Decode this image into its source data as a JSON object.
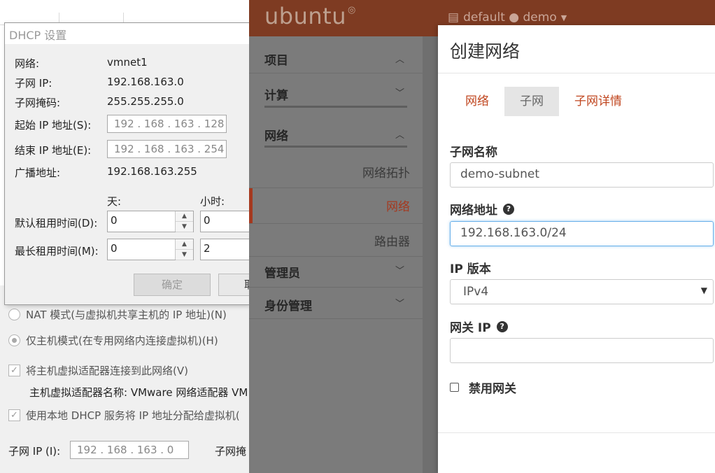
{
  "vmware": {
    "dhcp_dialog": {
      "title": "DHCP 设置",
      "network_label": "网络:",
      "network_value": "vmnet1",
      "subnet_ip_label": "子网 IP:",
      "subnet_ip_value": "192.168.163.0",
      "subnet_mask_label": "子网掩码:",
      "subnet_mask_value": "255.255.255.0",
      "start_ip_label": "起始 IP 地址(S):",
      "start_ip_value": "192 . 168 . 163 . 128",
      "end_ip_label": "结束 IP 地址(E):",
      "end_ip_value": "192 . 168 . 163 . 254",
      "broadcast_label": "广播地址:",
      "broadcast_value": "192.168.163.255",
      "days_header": "天:",
      "hours_header": "小时:",
      "default_lease_label": "默认租用时间(D):",
      "default_lease_days": "0",
      "default_lease_hours": "0",
      "max_lease_label": "最长租用时间(M):",
      "max_lease_days": "0",
      "max_lease_hours": "2",
      "ok_button": "确定",
      "cancel_button_partial": "取"
    },
    "nat_mode": "NAT 模式(与虚拟机共享主机的 IP 地址)(N)",
    "host_only_mode": "仅主机模式(在专用网络内连接虚拟机)(H)",
    "connect_adapter": "将主机虚拟适配器连接到此网络(V)",
    "adapter_name": "主机虚拟适配器名称: VMware 网络适配器 VM",
    "use_dhcp": "使用本地 DHCP 服务将 IP 地址分配给虚拟机(",
    "subnet_ip_label": "子网 IP (I):",
    "subnet_ip_value": "192 . 168 . 163 .   0",
    "subnet_mask_partial": "子网掩"
  },
  "openstack": {
    "logo": "ubuntu",
    "project_selector": "default ● demo",
    "sidebar": {
      "project": "项目",
      "compute": "计算",
      "network": "网络",
      "network_topology": "网络拓扑",
      "networks": "网络",
      "routers": "路由器",
      "admin": "管理员",
      "identity": "身份管理"
    },
    "modal": {
      "title": "创建网络",
      "tabs": [
        "网络",
        "子网",
        "子网详情"
      ],
      "subnet_name_label": "子网名称",
      "subnet_name_value": "demo-subnet",
      "network_address_label": "网络地址",
      "network_address_value": "192.168.163.0/24",
      "ip_version_label": "IP 版本",
      "ip_version_value": "IPv4",
      "gateway_ip_label": "网关 IP",
      "gateway_ip_value": "",
      "disable_gateway_label": "禁用网关"
    }
  }
}
